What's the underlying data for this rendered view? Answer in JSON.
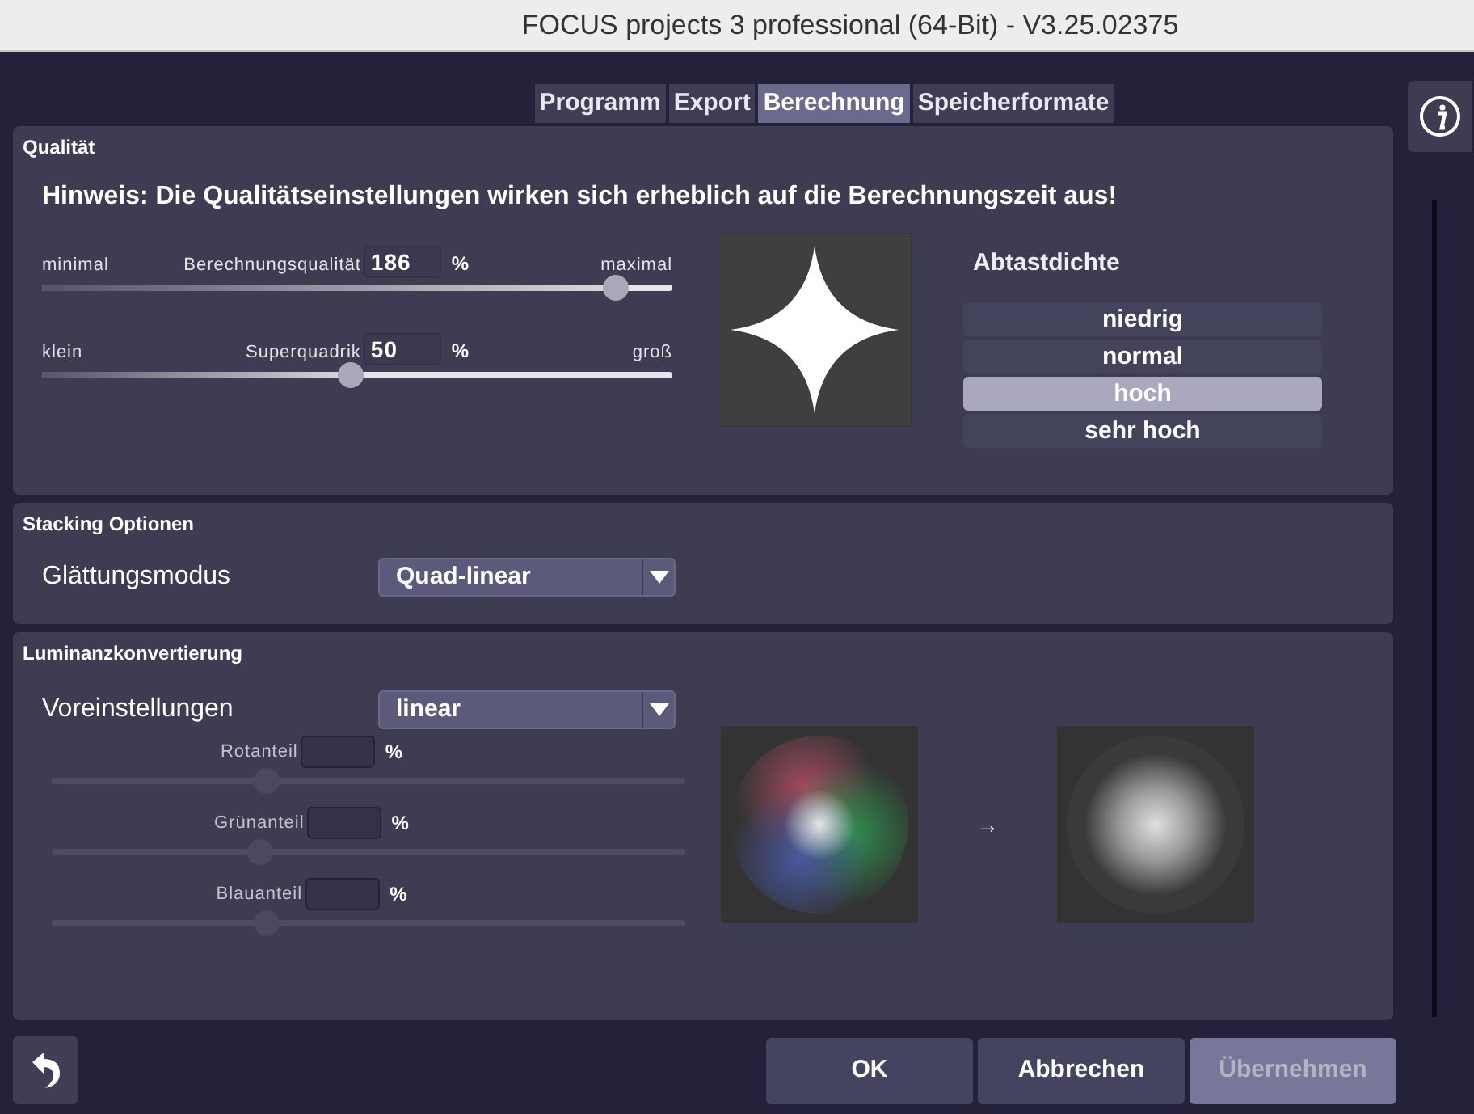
{
  "window": {
    "title": "FOCUS projects 3 professional (64-Bit) - V3.25.02375"
  },
  "tabs": [
    {
      "label": "Programm",
      "selected": false
    },
    {
      "label": "Export",
      "selected": false
    },
    {
      "label": "Berechnung",
      "selected": true
    },
    {
      "label": "Speicherformate",
      "selected": false
    }
  ],
  "quality": {
    "title": "Qualität",
    "hint": "Hinweis: Die Qualitätseinstellungen wirken sich erheblich auf die Berechnungszeit aus!",
    "sliders": [
      {
        "min_label": "minimal",
        "label": "Berechnungsqualität",
        "value": "186",
        "unit": "%",
        "max_label": "maximal",
        "level": 0.91
      },
      {
        "min_label": "klein",
        "label": "Superquadrik",
        "value": "50",
        "unit": "%",
        "max_label": "groß",
        "level": 0.49
      }
    ],
    "density": {
      "title": "Abtastdichte",
      "options": [
        {
          "label": "niedrig",
          "selected": false
        },
        {
          "label": "normal",
          "selected": false
        },
        {
          "label": "hoch",
          "selected": true
        },
        {
          "label": "sehr hoch",
          "selected": false
        }
      ]
    }
  },
  "stacking": {
    "title": "Stacking Optionen",
    "label": "Glättungsmodus",
    "value": "Quad-linear"
  },
  "luminance": {
    "title": "Luminanzkonvertierung",
    "label": "Voreinstellungen",
    "value": "linear",
    "sliders": [
      {
        "label": "Rotanteil",
        "unit": "%",
        "level": 0.34,
        "disabled": true
      },
      {
        "label": "Grünanteil",
        "unit": "%",
        "level": 0.33,
        "disabled": true
      },
      {
        "label": "Blauanteil",
        "unit": "%",
        "level": 0.34,
        "disabled": true
      }
    ],
    "arrow": "→"
  },
  "buttons": [
    {
      "label": "OK",
      "disabled": false
    },
    {
      "label": "Abbrechen",
      "disabled": false
    },
    {
      "label": "Übernehmen",
      "disabled": true
    }
  ]
}
